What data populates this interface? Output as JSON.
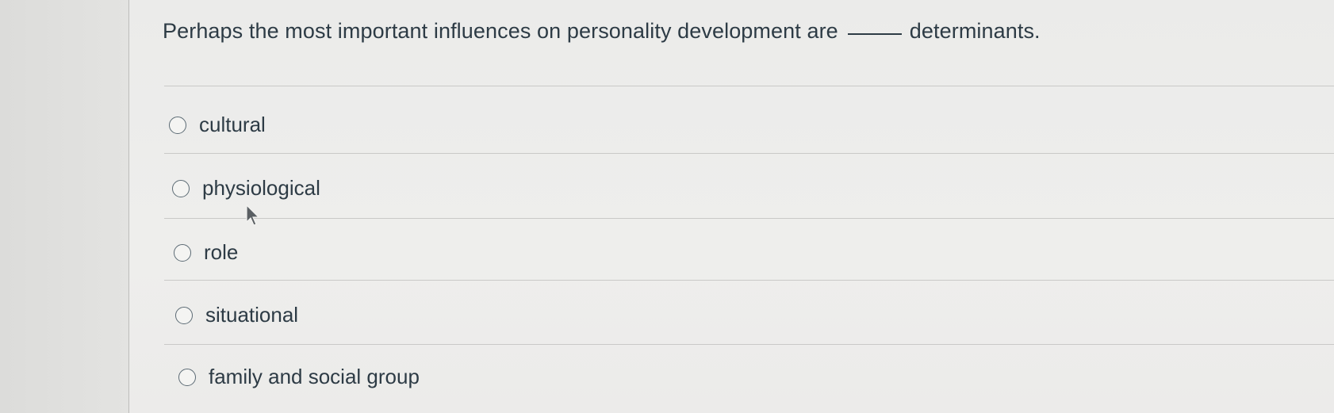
{
  "question": {
    "text_before": "Perhaps the most important influences on personality development are",
    "text_after": "determinants."
  },
  "answers": [
    {
      "label": "cultural"
    },
    {
      "label": "physiological"
    },
    {
      "label": "role"
    },
    {
      "label": "situational"
    },
    {
      "label": "family and social group"
    }
  ],
  "colors": {
    "text": "#2d3b45",
    "background": "#ebebea",
    "divider": "#c9c9c7"
  },
  "icons": {
    "cursor": "mouse-pointer-icon",
    "radio": "radio-button-icon"
  }
}
